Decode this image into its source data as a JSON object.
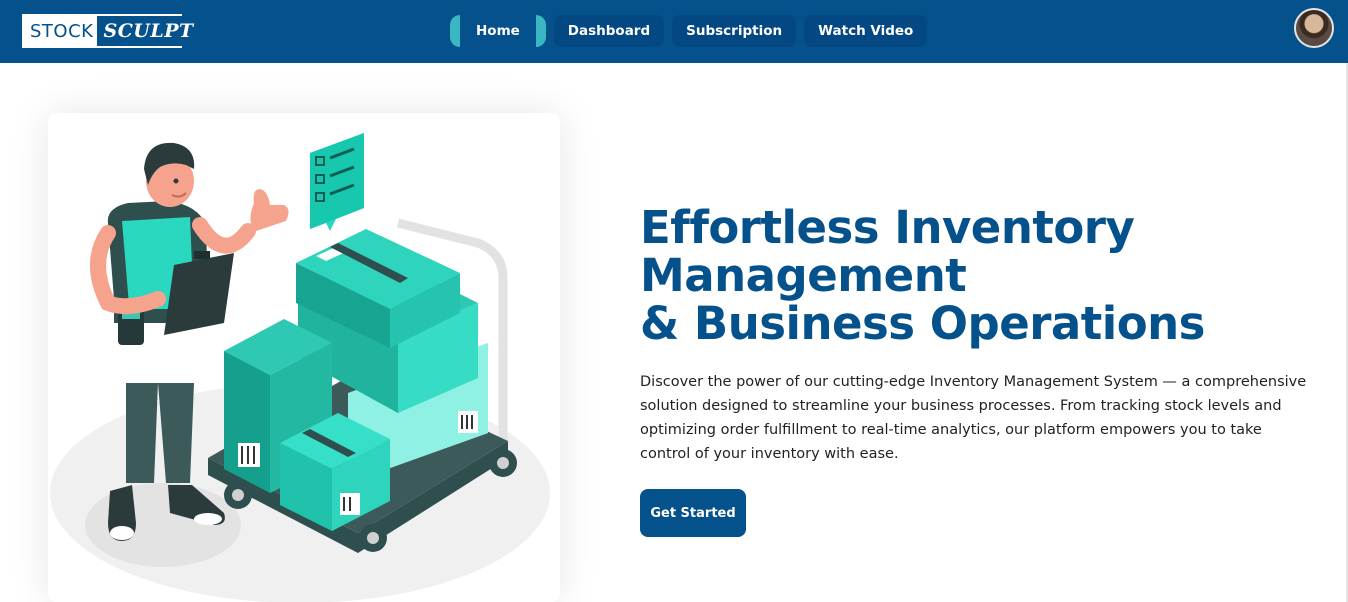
{
  "logo": {
    "part1": "STOCK",
    "part2": "SCULPT"
  },
  "nav": {
    "items": [
      {
        "label": "Home",
        "active": true
      },
      {
        "label": "Dashboard",
        "active": false
      },
      {
        "label": "Subscription",
        "active": false
      },
      {
        "label": "Watch Video",
        "active": false
      }
    ]
  },
  "hero": {
    "title_line1": "Effortless Inventory",
    "title_line2": "Management",
    "title_line3": "& Business Operations",
    "description": "Discover the power of our cutting-edge Inventory Management System — a comprehensive solution designed to streamline your business processes. From tracking stock levels and optimizing order fulfillment to real-time analytics, our platform empowers you to take control of your inventory with ease.",
    "cta_label": "Get Started"
  },
  "colors": {
    "brand": "#04518b",
    "accent": "#3bb7c2",
    "box": "#2ad8c0"
  },
  "icons": {
    "avatar": "user-avatar",
    "illustration": "warehouse-worker-illustration"
  }
}
